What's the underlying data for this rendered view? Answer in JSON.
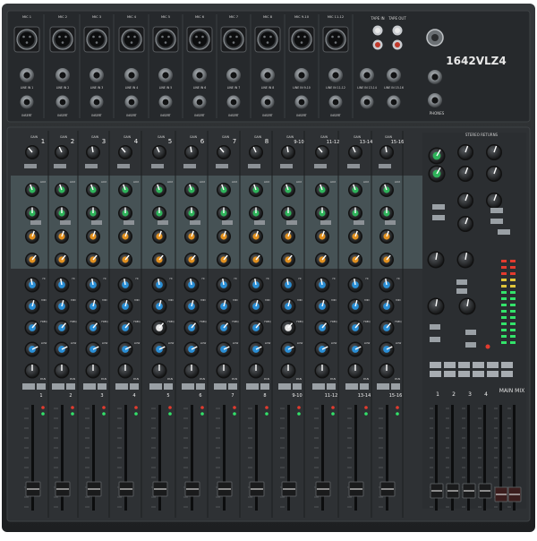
{
  "brand": {
    "model": "1642VLZ4"
  },
  "top_panel": {
    "mic_labels": [
      "MIC 1",
      "MIC 2",
      "MIC 3",
      "MIC 4",
      "MIC 5",
      "MIC 6",
      "MIC 7",
      "MIC 8",
      "MIC 9-10",
      "MIC 11-12"
    ],
    "line_labels": [
      "LINE IN 1",
      "LINE IN 2",
      "LINE IN 3",
      "LINE IN 4",
      "LINE IN 5",
      "LINE IN 6",
      "LINE IN 7",
      "LINE IN 8",
      "LINE IN 9-10",
      "LINE IN 11-12",
      "LINE IN 13-14",
      "LINE IN 15-16"
    ],
    "insert_label": "INSERT",
    "tape_in": "TAPE IN",
    "tape_out": "TAPE OUT",
    "phones_label": "PHONES"
  },
  "channel_strip": {
    "gain_label": "GAIN",
    "aux_label": "AUX",
    "eq_labels": [
      "HI",
      "MID",
      "FREQ",
      "LOW"
    ],
    "pan_label": "PAN",
    "mute_label": "MUTE"
  },
  "channel_numbers": [
    "1",
    "2",
    "3",
    "4",
    "5",
    "6",
    "7",
    "8",
    "9-10",
    "11-12",
    "13-14",
    "15-16"
  ],
  "stereo_returns": "STEREO RETURNS",
  "main_mix": "MAIN MIX",
  "subgroup_numbers": [
    "1",
    "2",
    "3",
    "4"
  ],
  "colors": {
    "chassis": "#2a2d30",
    "panel": "#2f3235",
    "aux_zone": "#4c5a5e",
    "knob_green": "#2eb35a",
    "knob_orange": "#e09020",
    "knob_blue": "#2a8fd6",
    "knob_white": "#e6e6e6",
    "led_green": "#33e36a",
    "led_red": "#e33b2e"
  }
}
